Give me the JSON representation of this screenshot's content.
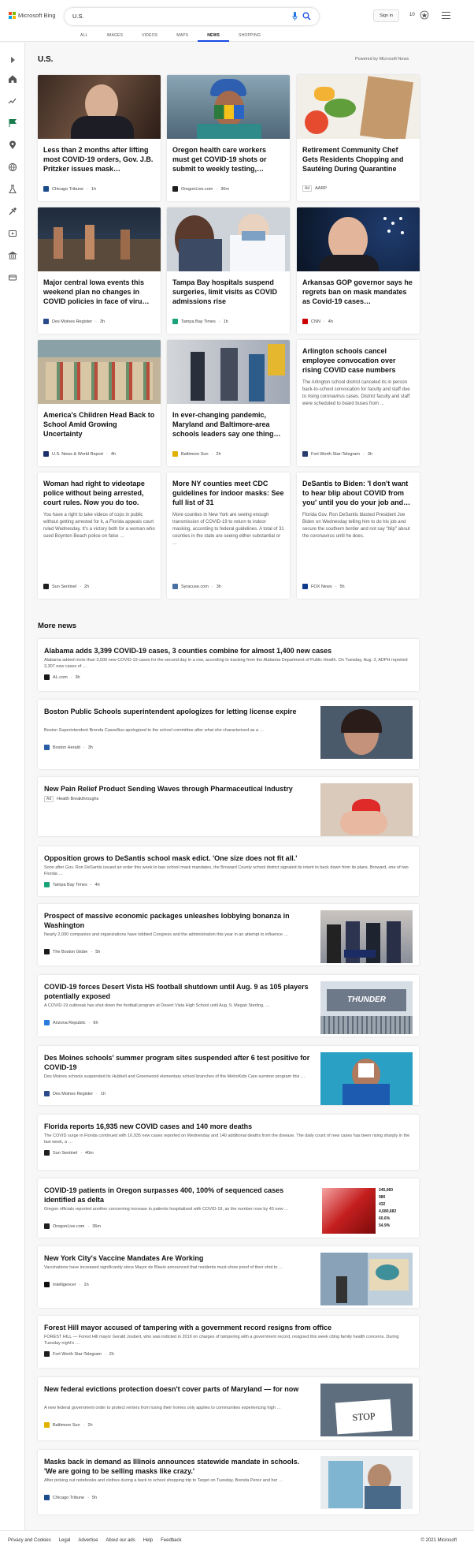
{
  "colors": {
    "accent": "#174ae4",
    "brand_red": "#f25022",
    "brand_green": "#7fba00",
    "brand_blue": "#00a4ef",
    "brand_yellow": "#ffb900"
  },
  "header": {
    "logo_text": "Microsoft Bing",
    "search_value": "U.S.",
    "sign_in": "Sign in",
    "rewards_count": "10",
    "icons": [
      "mic-icon",
      "search-icon",
      "rewards-icon",
      "menu-icon"
    ]
  },
  "tabs": [
    {
      "label": "ALL"
    },
    {
      "label": "IMAGES"
    },
    {
      "label": "VIDEOS"
    },
    {
      "label": "MAPS"
    },
    {
      "label": "NEWS",
      "active": true
    },
    {
      "label": "SHOPPING"
    }
  ],
  "rail": [
    "expand-icon",
    "home-icon",
    "trending-icon",
    "flag-icon",
    "location-icon",
    "globe-icon",
    "science-icon",
    "sports-icon",
    "entertainment-icon",
    "politics-icon",
    "money-icon"
  ],
  "section": {
    "title": "U.S.",
    "powered": "Powered by Microsoft News"
  },
  "cards": [
    {
      "title": "Less than 2 months after lifting most COVID-19 orders, Gov. J.B. Pritzker issues mask…",
      "source": "Chicago Tribune",
      "time": "1h"
    },
    {
      "title": "Oregon health care workers must get COVID-19 shots or submit to weekly testing,…",
      "source": "OregonLive.com",
      "time": "36m"
    },
    {
      "title": "Retirement Community Chef Gets Residents Chopping and Sautéing During Quarantine",
      "source": "AARP",
      "ad": "Ad"
    },
    {
      "title": "Major central Iowa events this weekend plan no changes in COVID policies in face of viru…",
      "source": "Des Moines Register",
      "time": "3h"
    },
    {
      "title": "Tampa Bay hospitals suspend surgeries, limit visits as COVID admissions rise",
      "source": "Tampa Bay Times",
      "time": "1h"
    },
    {
      "title": "Arkansas GOP governor says he regrets ban on mask mandates as Covid-19 cases…",
      "source": "CNN",
      "time": "4h"
    },
    {
      "title": "America's Children Head Back to School Amid Growing Uncertainty",
      "source": "U.S. News & World Report",
      "time": "4h"
    },
    {
      "title": "In ever-changing pandemic, Maryland and Baltimore-area schools leaders say one thing…",
      "source": "Baltimore Sun",
      "time": "2h"
    },
    {
      "title": "Arlington schools cancel employee convocation over rising COVID case numbers",
      "abstract": "The Arlington school district canceled its in person back-to-school convocation for faculty and staff due to rising coronavirus cases. District faculty and staff were scheduled to board buses from …",
      "source": "Fort Worth Star-Telegram",
      "time": "3h"
    },
    {
      "title": "Woman had right to videotape police without being arrested, court rules. Now you do too.",
      "abstract": "You have a right to take videos of cops in public without getting arrested for it, a Florida appeals court ruled Wednesday. It's a victory both for a woman who sued Boynton Beach police on false …",
      "source": "Sun Sentinel",
      "time": "2h"
    },
    {
      "title": "More NY counties meet CDC guidelines for indoor masks: See full list of 31",
      "abstract": "More counties in New York are seeing enough transmission of COVID-19 to return to indoor masking, according to federal guidelines. A total of 31 counties in the state are seeing either substantial or …",
      "source": "Syracuse.com",
      "time": "3h"
    },
    {
      "title": "DeSantis to Biden: 'I don't want to hear blip about COVID from you' until you do your job and…",
      "abstract": "Florida Gov. Ron DeSantis blasted President Joe Biden on Wednesday telling him to do his job and secure the southern border and not say \"blip\" about the coronavirus until he does.",
      "source": "FOX News",
      "time": "5h"
    }
  ],
  "more_news": {
    "title": "More news",
    "items": [
      {
        "title": "Alabama adds 3,399 COVID-19 cases, 3 counties combine for almost 1,400 new cases",
        "snippet": "Alabama added more than 3,000 new COVID-19 cases for the second day in a row, according to tracking from the Alabama Department of Public Health. On Tuesday, Aug. 3, ADPH reported 3,307 new cases of …",
        "source": "AL.com",
        "time": "3h"
      },
      {
        "title": "Boston Public Schools superintendent apologizes for letting license expire",
        "snippet": "Boston Superintendent Brenda Cassellius apologized to the school committee after what she characterized as a …",
        "source": "Boston Herald",
        "time": "3h"
      },
      {
        "title": "New Pain Relief Product Sending Waves through Pharmaceutical Industry",
        "ad": "Ad",
        "source": "Health Breakthroughs"
      },
      {
        "title": "Opposition grows to DeSantis school mask edict. 'One size does not fit all.'",
        "snippet": "Soon after Gov. Ron DeSantis issued an order this week to ban school mask mandates, the Broward County school district signaled its intent to back down from its plans. Broward, one of two Florida …",
        "source": "Tampa Bay Times",
        "time": "4h"
      },
      {
        "title": "Prospect of massive economic packages unleashes lobbying bonanza in Washington",
        "snippet": "Nearly 2,000 companies and organizations have lobbied Congress and the administration this year in an attempt to influence …",
        "source": "The Boston Globe",
        "time": "5h"
      },
      {
        "title": "COVID-19 forces Desert Vista HS football shutdown until Aug. 9 as 105 players potentially exposed",
        "snippet": "A COVID-19 outbreak has shut down the football program at Desert Vista High School until Aug. 9. Megan Sterling, …",
        "source": "Arizona Republic",
        "time": "6h",
        "thumb_text": "THUNDER"
      },
      {
        "title": "Des Moines schools' summer program sites suspended after 6 test positive for COVID-19",
        "snippet": "Des Moines schools suspended its Hubbell and Greenwood elementary school branches of the MetroKids Care summer program this …",
        "source": "Des Moines Register",
        "time": "1h"
      },
      {
        "title": "Florida reports 16,935 new COVID cases and 140 more deaths",
        "snippet": "The COVID surge in Florida continued with 16,935 new cases reported on Wednesday and 140 additional deaths from the disease. The daily count of new cases has been rising sharply in the last week, a …",
        "source": "Sun Sentinel",
        "time": "40m"
      },
      {
        "title": "COVID-19 patients in Oregon surpasses 400, 100% of sequenced cases identified as delta",
        "snippet": "Oregon officials reported another concerning increase in patients hospitalized with COVID-19, as the number rose by 43 new …",
        "source": "OregonLive.com",
        "time": "36m",
        "thumb_stats": [
          "245,083",
          "980",
          "432",
          "4,680,682",
          "60.6%",
          "54.9%"
        ]
      },
      {
        "title": "New York City's Vaccine Mandates Are Working",
        "snippet": "Vaccinations have increased significantly since Mayor de Blasio announced that residents must show proof of their shot to …",
        "source": "Intelligencer",
        "time": "1h"
      },
      {
        "title": "Forest Hill mayor accused of tampering with a government record resigns from office",
        "snippet": "FOREST HILL — Forest Hill mayor Gerald Joubert, who was indicted in 2019 on charges of tampering with a government record, resigned this week citing family health concerns. During Tuesday night's …",
        "source": "Fort Worth Star-Telegram",
        "time": "2h"
      },
      {
        "title": "New federal evictions protection doesn't cover parts of Maryland — for now",
        "snippet": "A new federal government order to protect renters from losing their homes only applies to communities experiencing high …",
        "source": "Baltimore Sun",
        "time": "2h",
        "thumb_text": "STOP"
      },
      {
        "title": "Masks back in demand as Illinois announces statewide mandate in schools. 'We are going to be selling masks like crazy.'",
        "snippet": "After picking out notebooks and clothes during a back to school shopping trip to Target on Tuesday, Brenda Perez and her …",
        "source": "Chicago Tribune",
        "time": "5h"
      }
    ]
  },
  "footer": {
    "links": [
      "Privacy and Cookies",
      "Legal",
      "Advertise",
      "About our ads",
      "Help",
      "Feedback"
    ],
    "copyright": "© 2021 Microsoft"
  }
}
